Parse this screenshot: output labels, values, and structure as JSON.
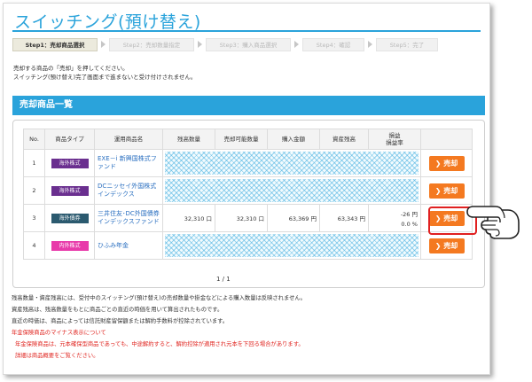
{
  "page_title": "スイッチング(預け替え)",
  "steps": [
    {
      "label": "Step1：売却商品選択",
      "active": true
    },
    {
      "label": "Step2：売却数量指定",
      "active": false
    },
    {
      "label": "Step3：購入商品選択",
      "active": false
    },
    {
      "label": "Step4：確認",
      "active": false
    },
    {
      "label": "Step5：完了",
      "active": false
    }
  ],
  "intro": [
    "売却する商品の「売却」を押してください。",
    "スイッチング(預け替え)完了画面まで進まないと受け付けされません。"
  ],
  "section_title": "売却商品一覧",
  "table": {
    "headers": [
      "No.",
      "商品タイプ",
      "運用商品名",
      "残高数量",
      "売却可能数量",
      "購入金額",
      "資産残高",
      "損益\n損益率"
    ],
    "rows": [
      {
        "no": "1",
        "type": "海外株式",
        "type_color": "#6a2f8f",
        "name": "EXE－i 新興国株式ファンド",
        "qty": "",
        "sellable": "",
        "purchase": "",
        "asset": "",
        "pl": "",
        "pl_rate": "",
        "hatched": true,
        "sell_label": "売却"
      },
      {
        "no": "2",
        "type": "海外株式",
        "type_color": "#6a2f8f",
        "name": "DCニッセイ外国株式インデックス",
        "qty": "",
        "sellable": "",
        "purchase": "",
        "asset": "",
        "pl": "",
        "pl_rate": "",
        "hatched": true,
        "sell_label": "売却"
      },
      {
        "no": "3",
        "type": "海外債券",
        "type_color": "#2b5a6f",
        "name": "三井住友･DC外国債券インデックスファンド",
        "qty": "32,310 口",
        "sellable": "32,310 口",
        "purchase": "63,369 円",
        "asset": "63,343 円",
        "pl": "-26 円",
        "pl_rate": "0.0 %",
        "hatched": false,
        "sell_label": "売却"
      },
      {
        "no": "4",
        "type": "内外株式",
        "type_color": "#e83aaa",
        "name": "ひふみ年金",
        "qty": "",
        "sellable": "",
        "purchase": "",
        "asset": "",
        "pl": "",
        "pl_rate": "",
        "hatched": true,
        "sell_label": "売却"
      }
    ]
  },
  "pager": "1 / 1",
  "notes": {
    "black": [
      "残高数量・資産残高には、受付中のスイッチング(預け替え)の売却数量や掛金などによる購入数量は反映されません。",
      "資産残高は、残高数量をもとに商品ごとの直近の時価を用いて算出されたものです。",
      "直近の時価は、商品によっては信託財産留保額または解約手数料が控除されています。"
    ],
    "red_heading": "年金保険商品のマイナス表示について",
    "red": [
      "年金保険商品は、元本確保型商品であっても、中途解約すると、解約控除が適用され元本を下回る場合があります。",
      "詳細は商品概要をご覧ください。"
    ]
  },
  "colors": {
    "accent": "#2aa3db",
    "sell_button": "#f47920",
    "highlight": "#e02020"
  },
  "icons": {
    "pointer": "pointing-hand-icon",
    "chevron": "chevron-right-icon"
  }
}
